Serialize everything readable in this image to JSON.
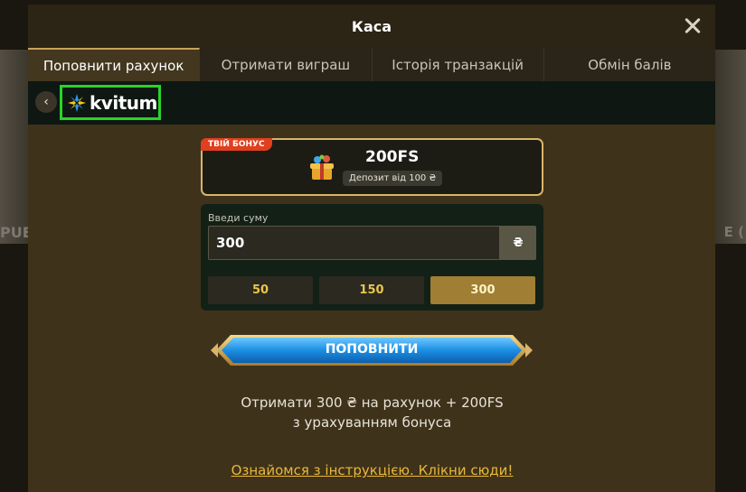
{
  "modal": {
    "title": "Каса"
  },
  "tabs": [
    {
      "label": "Поповнити рахунок",
      "active": true
    },
    {
      "label": "Отримати виграш",
      "active": false
    },
    {
      "label": "Історія транзакцій",
      "active": false
    },
    {
      "label": "Обмін балів",
      "active": false
    }
  ],
  "provider": {
    "name": "kvitum"
  },
  "bonus": {
    "badge": "ТВІЙ БОНУС",
    "amount": "200FS",
    "note": "Депозит від 100 ₴"
  },
  "amount": {
    "label": "Введи суму",
    "value": "300",
    "currency": "₴",
    "presets": [
      "50",
      "150",
      "300"
    ],
    "selected": "300"
  },
  "deposit": {
    "label": "ПОПОВНИТИ"
  },
  "summary": {
    "line1": "Отримати 300 ₴ на рахунок + 200FS",
    "line2": "з урахуванням бонуса"
  },
  "instructions": {
    "link": "Ознайомся з інструкцією. Клікни сюди!"
  },
  "background": {
    "left_text": "PUE",
    "right_text": "E ("
  },
  "colors": {
    "accent_gold": "#e8b83a",
    "highlight_green": "#29d32b",
    "button_blue": "#1a8fe0"
  }
}
